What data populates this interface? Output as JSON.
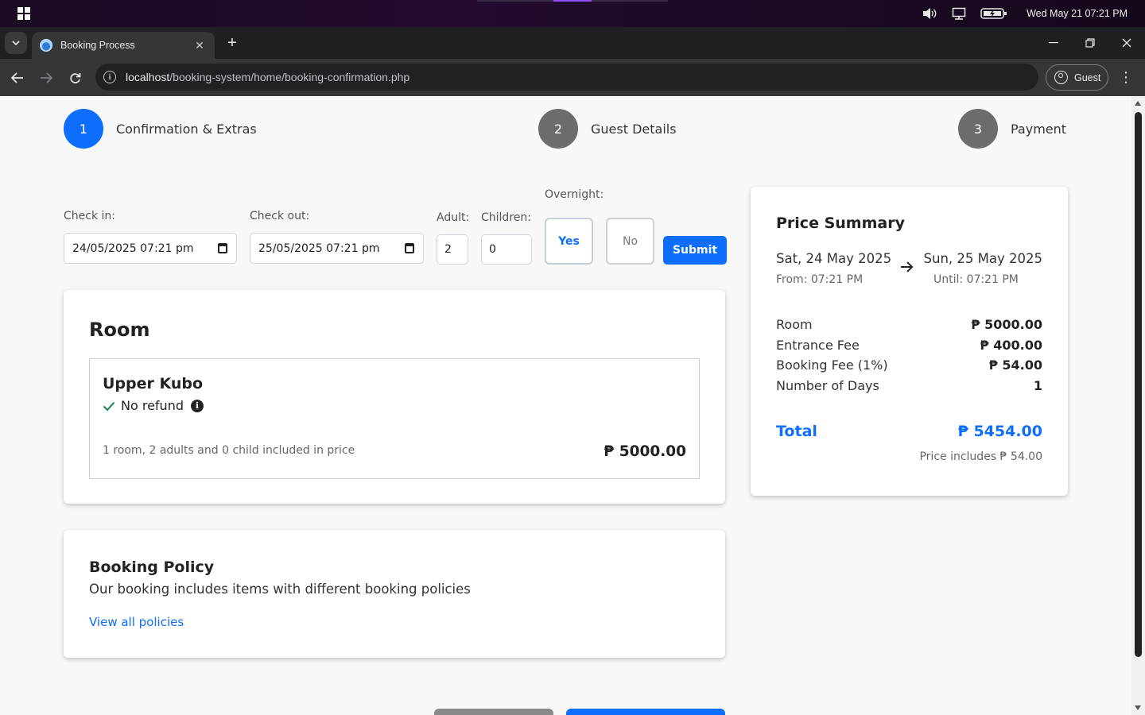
{
  "os": {
    "clock": "Wed May 21  07:21 PM",
    "icons": [
      "windows-icon",
      "volume-icon",
      "display-icon",
      "battery-icon"
    ]
  },
  "browser": {
    "tab_title": "Booking Process",
    "new_tab": "+",
    "url_host": "localhost",
    "url_path": "/booking-system/home/booking-confirmation.php",
    "profile_label": "Guest"
  },
  "steps": [
    {
      "number": "1",
      "label": "Confirmation & Extras",
      "state": "active"
    },
    {
      "number": "2",
      "label": "Guest Details",
      "state": "inactive"
    },
    {
      "number": "3",
      "label": "Payment",
      "state": "inactive"
    }
  ],
  "form": {
    "check_in_label": "Check in:",
    "check_in_value": "24/05/2025 07:21 pm",
    "check_out_label": "Check out:",
    "check_out_value": "25/05/2025 07:21 pm",
    "adult_label": "Adult:",
    "adult_value": "2",
    "children_label": "Children:",
    "children_value": "0",
    "overnight_label": "Overnight:",
    "overnight_yes": "Yes",
    "overnight_no": "No",
    "overnight_selected": "Yes",
    "submit_label": "Submit"
  },
  "room": {
    "section_title": "Room",
    "name": "Upper Kubo",
    "refund": "No refund",
    "description": "1 room, 2 adults and 0 child included in price",
    "price": "₱ 5000.00"
  },
  "policy": {
    "title": "Booking Policy",
    "text": "Our booking includes items with different booking policies",
    "link": "View all policies"
  },
  "summary": {
    "title": "Price Summary",
    "from_date": "Sat, 24 May 2025",
    "from_time": "From: 07:21 PM",
    "until_date": "Sun, 25 May 2025",
    "until_time": "Until: 07:21 PM",
    "rows": [
      {
        "label": "Room",
        "value": "₱ 5000.00"
      },
      {
        "label": "Entrance Fee",
        "value": "₱ 400.00"
      },
      {
        "label": "Booking Fee (1%)",
        "value": "₱ 54.00"
      },
      {
        "label": "Number of Days",
        "value": "1"
      }
    ],
    "total_label": "Total",
    "total_value": "₱ 5454.00",
    "includes": "Price includes ₱ 54.00"
  },
  "colors": {
    "accent": "#0d6efd",
    "step_inactive": "#6c6c6c",
    "page_bg": "#f8f8f8",
    "success": "#198754"
  }
}
